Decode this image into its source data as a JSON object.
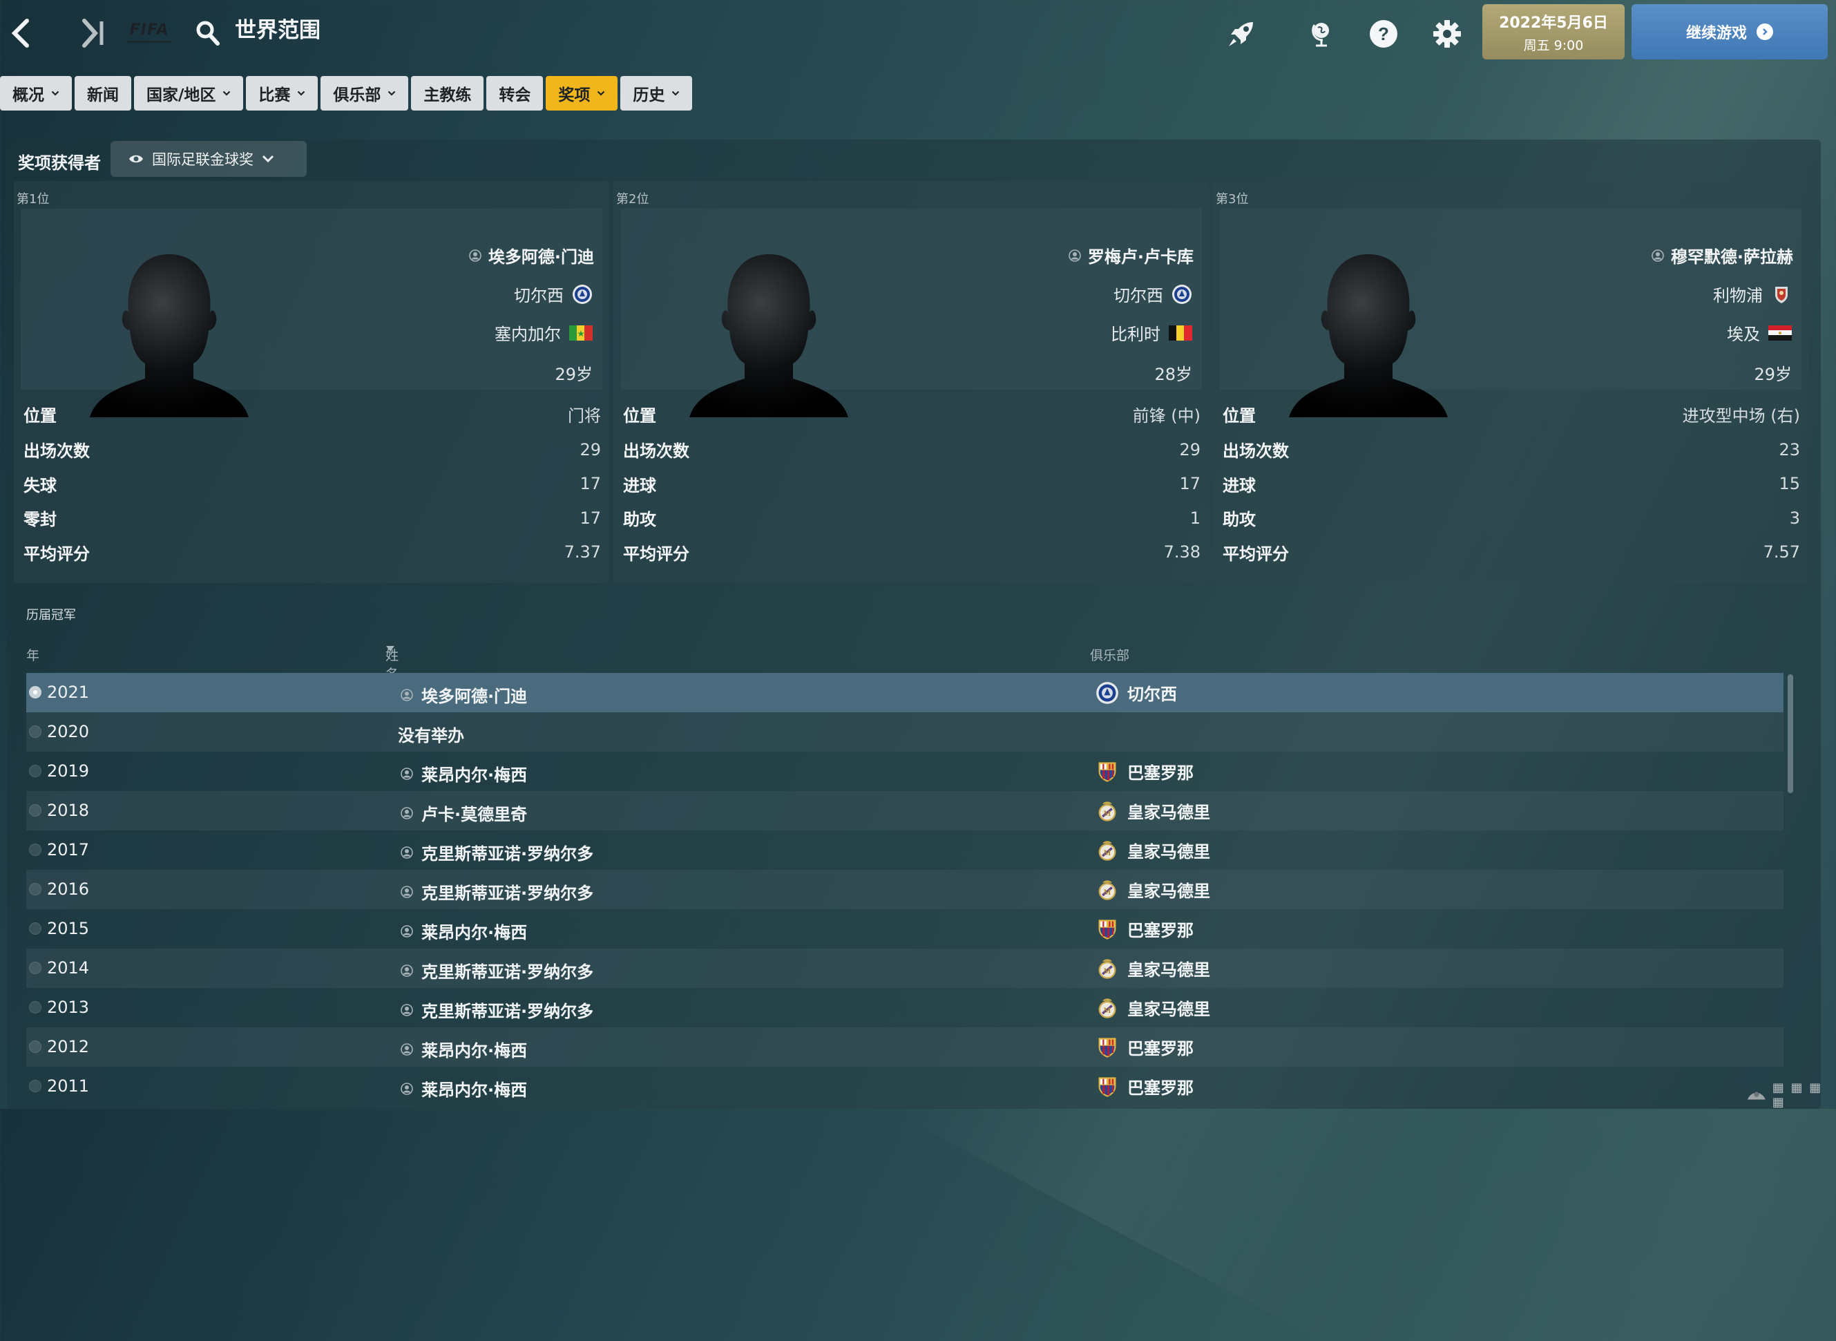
{
  "header": {
    "title": "世界范围",
    "logo_text": "FIFA",
    "date": "2022年5月6日",
    "weekday_time": "周五 9:00",
    "continue_label": "继续游戏"
  },
  "menu": [
    {
      "label": "概况",
      "dropdown": true
    },
    {
      "label": "新闻",
      "dropdown": false
    },
    {
      "label": "国家/地区",
      "dropdown": true
    },
    {
      "label": "比赛",
      "dropdown": true
    },
    {
      "label": "俱乐部",
      "dropdown": true
    },
    {
      "label": "主教练",
      "dropdown": false
    },
    {
      "label": "转会",
      "dropdown": false
    },
    {
      "label": "奖项",
      "dropdown": true,
      "active": true
    },
    {
      "label": "历史",
      "dropdown": true
    }
  ],
  "awards": {
    "label": "奖项获得者",
    "selected_award": "国际足联金球奖"
  },
  "winners": [
    {
      "rank": "第1位",
      "name": "埃多阿德·门迪",
      "club": "切尔西",
      "club_icon": "chelsea-badge",
      "nation": "塞内加尔",
      "flag": "senegal",
      "age": "29岁",
      "stats": [
        {
          "label": "位置",
          "value": "门将"
        },
        {
          "label": "出场次数",
          "value": "29"
        },
        {
          "label": "失球",
          "value": "17"
        },
        {
          "label": "零封",
          "value": "17"
        },
        {
          "label": "平均评分",
          "value": "7.37"
        }
      ]
    },
    {
      "rank": "第2位",
      "name": "罗梅卢·卢卡库",
      "club": "切尔西",
      "club_icon": "chelsea-badge",
      "nation": "比利时",
      "flag": "belgium",
      "age": "28岁",
      "stats": [
        {
          "label": "位置",
          "value": "前锋 (中)"
        },
        {
          "label": "出场次数",
          "value": "29"
        },
        {
          "label": "进球",
          "value": "17"
        },
        {
          "label": "助攻",
          "value": "1"
        },
        {
          "label": "平均评分",
          "value": "7.38"
        }
      ]
    },
    {
      "rank": "第3位",
      "name": "穆罕默德·萨拉赫",
      "club": "利物浦",
      "club_icon": "liverpool-badge",
      "nation": "埃及",
      "flag": "egypt",
      "age": "29岁",
      "stats": [
        {
          "label": "位置",
          "value": "进攻型中场 (右)"
        },
        {
          "label": "出场次数",
          "value": "23"
        },
        {
          "label": "进球",
          "value": "15"
        },
        {
          "label": "助攻",
          "value": "3"
        },
        {
          "label": "平均评分",
          "value": "7.57"
        }
      ]
    }
  ],
  "history": {
    "title": "历届冠军",
    "columns": {
      "year": "年",
      "name": "姓名",
      "club": "俱乐部"
    },
    "rows": [
      {
        "year": "2021",
        "name": "埃多阿德·门迪",
        "club": "切尔西",
        "club_icon": "chelsea-badge",
        "selected": true
      },
      {
        "year": "2020",
        "name": "没有举办",
        "club": "",
        "club_icon": "",
        "no_player": true
      },
      {
        "year": "2019",
        "name": "莱昂内尔·梅西",
        "club": "巴塞罗那",
        "club_icon": "barcelona-badge"
      },
      {
        "year": "2018",
        "name": "卢卡·莫德里奇",
        "club": "皇家马德里",
        "club_icon": "real-madrid-badge"
      },
      {
        "year": "2017",
        "name": "克里斯蒂亚诺·罗纳尔多",
        "club": "皇家马德里",
        "club_icon": "real-madrid-badge"
      },
      {
        "year": "2016",
        "name": "克里斯蒂亚诺·罗纳尔多",
        "club": "皇家马德里",
        "club_icon": "real-madrid-badge"
      },
      {
        "year": "2015",
        "name": "莱昂内尔·梅西",
        "club": "巴塞罗那",
        "club_icon": "barcelona-badge"
      },
      {
        "year": "2014",
        "name": "克里斯蒂亚诺·罗纳尔多",
        "club": "皇家马德里",
        "club_icon": "real-madrid-badge"
      },
      {
        "year": "2013",
        "name": "克里斯蒂亚诺·罗纳尔多",
        "club": "皇家马德里",
        "club_icon": "real-madrid-badge"
      },
      {
        "year": "2012",
        "name": "莱昂内尔·梅西",
        "club": "巴塞罗那",
        "club_icon": "barcelona-badge"
      },
      {
        "year": "2011",
        "name": "莱昂内尔·梅西",
        "club": "巴塞罗那",
        "club_icon": "barcelona-badge"
      }
    ]
  },
  "colors": {
    "active_tab": "#f2b61d",
    "continue_button": "#4a82bf",
    "date_box": "#a69c6b",
    "selected_row": "#4a6a7e"
  }
}
